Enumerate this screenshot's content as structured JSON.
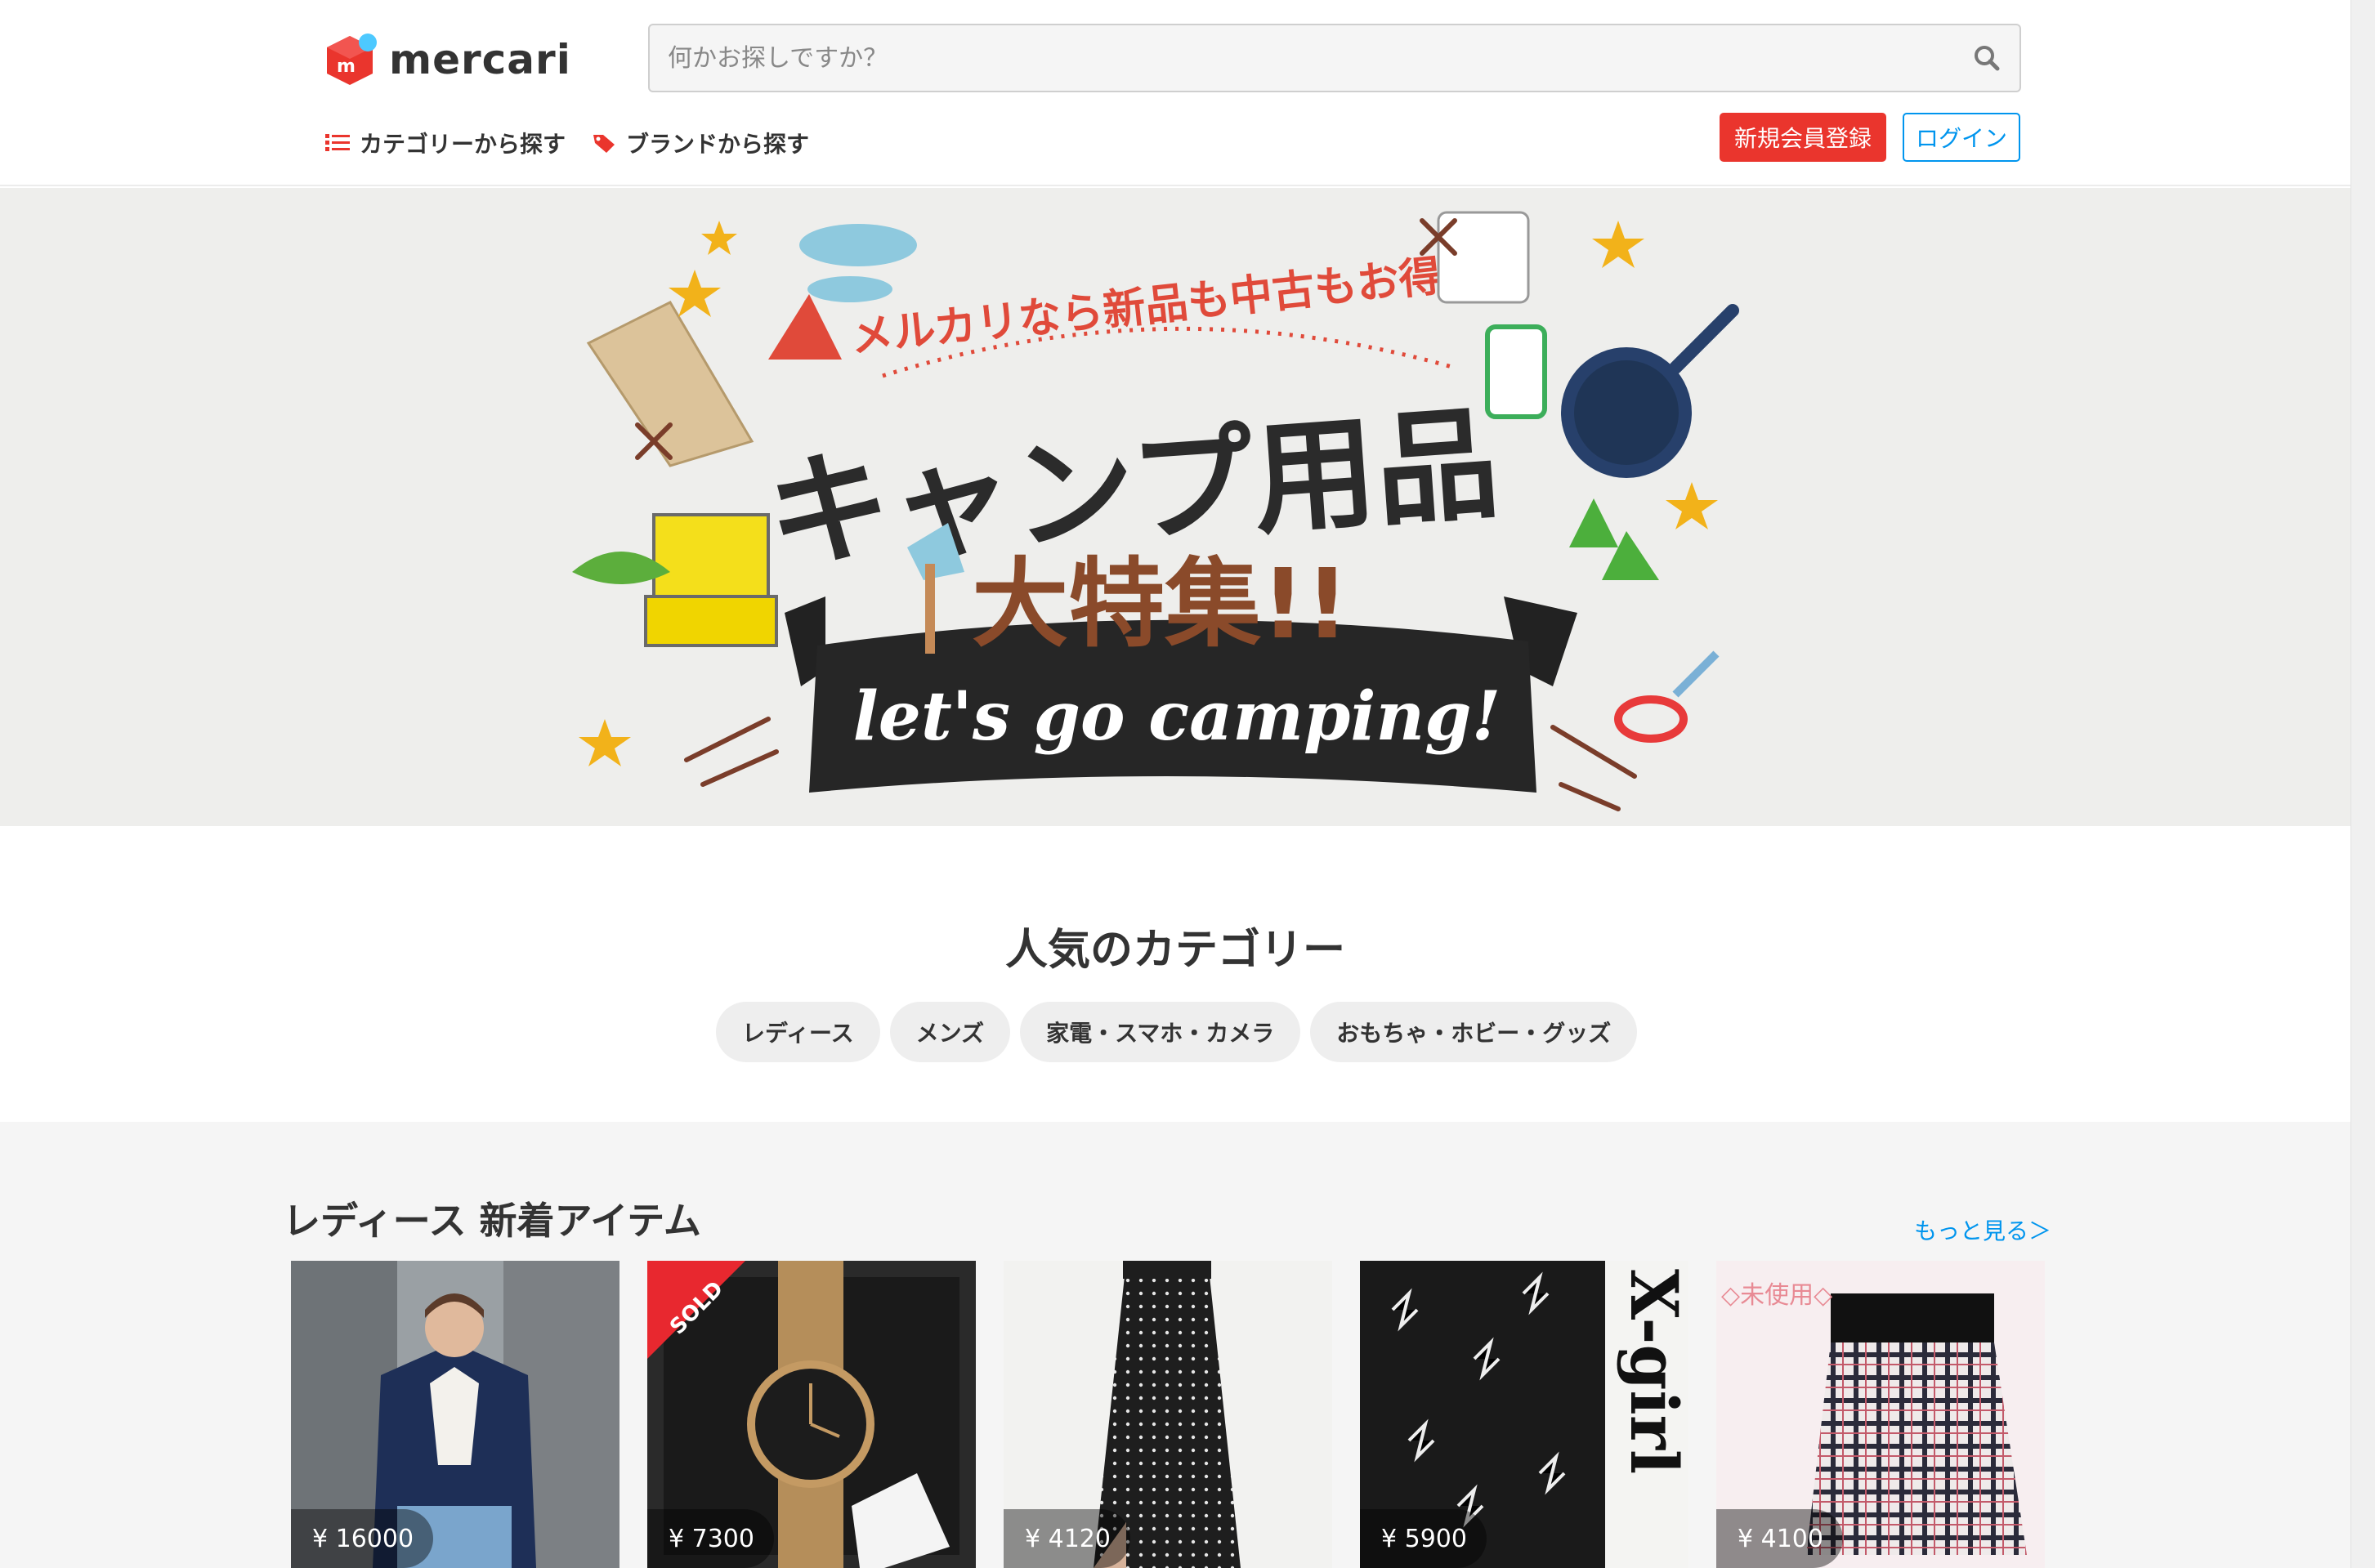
{
  "app": {
    "logo_text": "mercari"
  },
  "search": {
    "placeholder": "何かお探しですか？"
  },
  "nav": {
    "items": [
      {
        "label": "カテゴリーから探す",
        "icon": "list-icon"
      },
      {
        "label": "ブランドから探す",
        "icon": "tag-icon"
      }
    ]
  },
  "header": {
    "signup_label": "新規会員登録",
    "login_label": "ログイン"
  },
  "banner": {
    "headline_small": "メルカリなら新品も中古もお得！",
    "headline_large": "キャンプ用品",
    "headline_large2": "大特集!!",
    "ribbon_text": "let's go camping!",
    "slide_count": 2,
    "active_slide": 2
  },
  "popular": {
    "title": "人気のカテゴリー",
    "categories": [
      "レディース",
      "メンズ",
      "家電・スマホ・カメラ",
      "おもちゃ・ホビー・グッズ"
    ]
  },
  "new_items": {
    "title": "レディース 新着アイテム",
    "more_label": "もっと見る＞",
    "items": [
      {
        "price": "¥ 16000",
        "sold": false
      },
      {
        "price": "¥ 7300",
        "sold": true,
        "sold_label": "SOLD"
      },
      {
        "price": "¥ 4120",
        "sold": false
      },
      {
        "price": "¥ 5900",
        "sold": false,
        "overlay_text": "X-girl"
      },
      {
        "price": "¥ 4100",
        "sold": false,
        "overlay_text": "◇未使用◇"
      }
    ]
  },
  "colors": {
    "brand_red": "#ea352d",
    "link_blue": "#0095ee",
    "accent_blue": "#4dc9ff"
  }
}
